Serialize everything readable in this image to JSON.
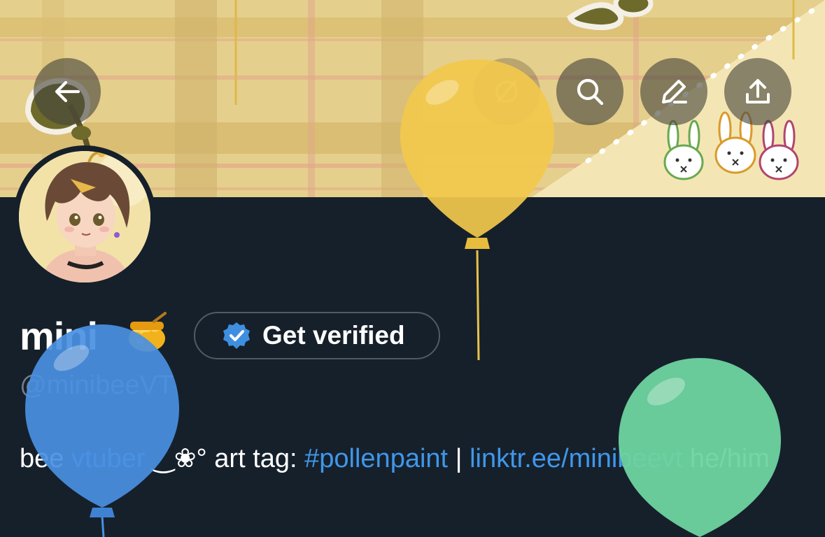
{
  "header": {
    "buttons": [
      {
        "name": "back-button",
        "icon": "arrow-left-icon"
      },
      {
        "name": "grok-button",
        "icon": "slash-circle-icon"
      },
      {
        "name": "search-button",
        "icon": "search-icon"
      },
      {
        "name": "edit-button",
        "icon": "pencil-icon"
      },
      {
        "name": "share-button",
        "icon": "share-icon"
      }
    ]
  },
  "profile": {
    "display_name": "mini",
    "name_emoji": "honey-pot-icon",
    "get_verified_label": "Get verified",
    "handle": "@minibeeVT",
    "bio": {
      "text1": "bee ",
      "link1": "vtuber",
      "text2": " ‿❀° art tag: ",
      "hashtag": "#pollenpaint",
      "sep": " | ",
      "link2": "linktr.ee/minibeevt",
      "text3": " he/him"
    }
  },
  "colors": {
    "background": "#16202b",
    "link": "#3f97ea",
    "verified_badge": "#3f8fe0",
    "balloon_yellow": "#f2c94c",
    "balloon_blue": "#4a90e2",
    "balloon_green": "#6ed4a0"
  }
}
